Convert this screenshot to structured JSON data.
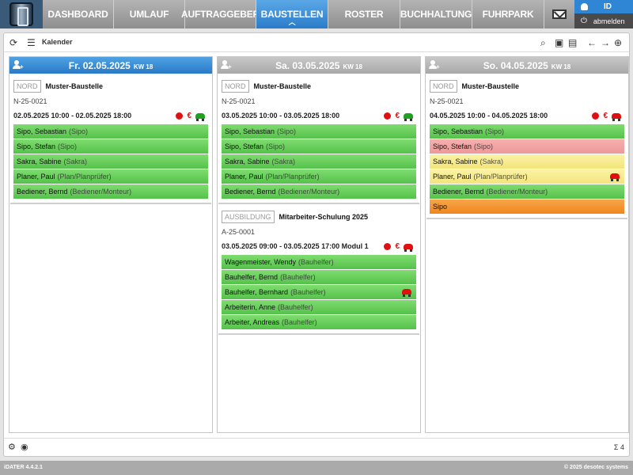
{
  "nav": {
    "tabs": [
      {
        "label": "DASHBOARD",
        "active": false
      },
      {
        "label": "UMLAUF",
        "active": false
      },
      {
        "label": "AUFTRAGGEBER",
        "active": false
      },
      {
        "label": "BAUSTELLEN",
        "active": true
      },
      {
        "label": "ROSTER",
        "active": false
      },
      {
        "label": "BUCHHALTUNG",
        "active": false
      },
      {
        "label": "FUHRPARK",
        "active": false
      }
    ],
    "user": "ID",
    "logout": "abmelden"
  },
  "toolbar": {
    "title": "Kalender"
  },
  "days": [
    {
      "date": "Fr. 02.05.2025",
      "kw": "KW 18",
      "today": true,
      "jobs": [
        {
          "region": "NORD",
          "name": "Muster-Baustelle",
          "number": "N-25-0021",
          "time": "02.05.2025 10:00 - 02.05.2025 18:00",
          "car_color": "green",
          "staff": [
            {
              "name": "Sipo, Sebastian",
              "role": "(Sipo)",
              "color": "green",
              "car": false
            },
            {
              "name": "Sipo, Stefan",
              "role": "(Sipo)",
              "color": "green",
              "car": false
            },
            {
              "name": "Sakra, Sabine",
              "role": "(Sakra)",
              "color": "green",
              "car": false
            },
            {
              "name": "Planer, Paul",
              "role": "(Plan/Planprüfer)",
              "color": "green",
              "car": false
            },
            {
              "name": "Bediener, Bernd",
              "role": "(Bediener/Monteur)",
              "color": "green",
              "car": false
            }
          ]
        }
      ]
    },
    {
      "date": "Sa. 03.05.2025",
      "kw": "KW 18",
      "today": false,
      "jobs": [
        {
          "region": "NORD",
          "name": "Muster-Baustelle",
          "number": "N-25-0021",
          "time": "03.05.2025 10:00 - 03.05.2025 18:00",
          "car_color": "green",
          "staff": [
            {
              "name": "Sipo, Sebastian",
              "role": "(Sipo)",
              "color": "green",
              "car": false
            },
            {
              "name": "Sipo, Stefan",
              "role": "(Sipo)",
              "color": "green",
              "car": false
            },
            {
              "name": "Sakra, Sabine",
              "role": "(Sakra)",
              "color": "green",
              "car": false
            },
            {
              "name": "Planer, Paul",
              "role": "(Plan/Planprüfer)",
              "color": "green",
              "car": false
            },
            {
              "name": "Bediener, Bernd",
              "role": "(Bediener/Monteur)",
              "color": "green",
              "car": false
            }
          ]
        },
        {
          "region": "AUSBILDUNG",
          "name": "Mitarbeiter-Schulung 2025",
          "number": "A-25-0001",
          "time": "03.05.2025 09:00 - 03.05.2025 17:00 Modul 1",
          "car_color": "red",
          "staff": [
            {
              "name": "Wagenmeister, Wendy",
              "role": "(Bauhelfer)",
              "color": "green",
              "car": false
            },
            {
              "name": "Bauhelfer, Bernd",
              "role": "(Bauhelfer)",
              "color": "green",
              "car": false
            },
            {
              "name": "Bauhelfer, Bernhard",
              "role": "(Bauhelfer)",
              "color": "green",
              "car": true
            },
            {
              "name": "Arbeiterin, Anne",
              "role": "(Bauhelfer)",
              "color": "green",
              "car": false
            },
            {
              "name": "Arbeiter, Andreas",
              "role": "(Bauhelfer)",
              "color": "green",
              "car": false
            }
          ]
        }
      ]
    },
    {
      "date": "So. 04.05.2025",
      "kw": "KW 18",
      "today": false,
      "jobs": [
        {
          "region": "NORD",
          "name": "Muster-Baustelle",
          "number": "N-25-0021",
          "time": "04.05.2025 10:00 - 04.05.2025 18:00",
          "car_color": "red",
          "staff": [
            {
              "name": "Sipo, Sebastian",
              "role": "(Sipo)",
              "color": "green",
              "car": false
            },
            {
              "name": "Sipo, Stefan",
              "role": "(Sipo)",
              "color": "red",
              "car": false
            },
            {
              "name": "Sakra, Sabine",
              "role": "(Sakra)",
              "color": "yellow",
              "car": false
            },
            {
              "name": "Planer, Paul",
              "role": "(Plan/Planprüfer)",
              "color": "yellow",
              "car": true
            },
            {
              "name": "Bediener, Bernd",
              "role": "(Bediener/Monteur)",
              "color": "green",
              "car": false
            },
            {
              "name": "Sipo",
              "role": "",
              "color": "orange",
              "car": false
            }
          ]
        }
      ]
    }
  ],
  "footer": {
    "sum": "Σ 4"
  },
  "status": {
    "version": "iDATER 4.4.2.1",
    "copyright": "© 2025   desotec systems"
  }
}
